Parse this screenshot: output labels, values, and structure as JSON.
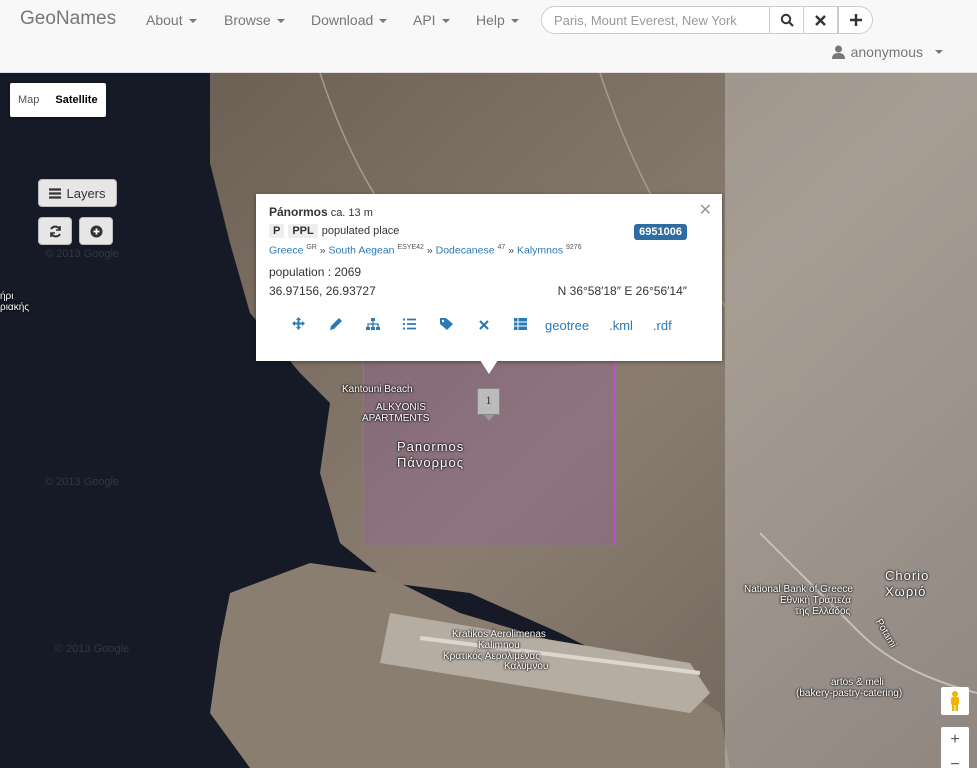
{
  "navbar": {
    "brand": "GeoNames",
    "menu": [
      {
        "label": "About"
      },
      {
        "label": "Browse"
      },
      {
        "label": "Download"
      },
      {
        "label": "API"
      },
      {
        "label": "Help"
      }
    ],
    "search_placeholder": "Paris, Mount Everest, New York",
    "search_buttons": [
      "search-icon",
      "clear-icon",
      "add-icon"
    ],
    "user": "anonymous"
  },
  "map": {
    "type_control": {
      "map": "Map",
      "satellite": "Satellite",
      "active": "Satellite"
    },
    "layers_label": "Layers",
    "watermark": "© 2013 Google",
    "labels": {
      "kantouni": "Kantouni Beach",
      "alkyonis1": "ALKYONIS",
      "alkyonis2": "APARTMENTS",
      "panormos_en": "Panormos",
      "panormos_gr": "Πάνορμος",
      "chorio_en": "Chorio",
      "chorio_gr": "Χωριό",
      "bank1": "National Bank of Greece",
      "bank2": "Εθνική Τράπεζα",
      "bank3": "της Ελλάδος",
      "potami": "Potami",
      "airport1": "Kratikos Aerolimenas",
      "airport2": "Kalimnou",
      "airport3": "Κρατικός Αερολιμένας",
      "airport4": "Καλύμνου",
      "bakery1": "artos & meli",
      "bakery2": "(bakery-pastry-catering)",
      "edge1": "ήρι",
      "edge2": "ριακής"
    },
    "marker_label": "1"
  },
  "popup": {
    "name": "Pánormos",
    "elevation": "ca. 13 m",
    "feature_class": "P",
    "feature_code": "PPL",
    "feature_desc": "populated place",
    "geonameid": "6951006",
    "hierarchy": [
      {
        "name": "Greece",
        "code": "GR"
      },
      {
        "name": "South Aegean",
        "code": "ESYE42"
      },
      {
        "name": "Dodecanese",
        "code": "47"
      },
      {
        "name": "Kalymnos",
        "code": "9276"
      }
    ],
    "population": "population : 2069",
    "coords": "36.97156, 26.93727",
    "dms": "N 36°58′18″ E 26°56′14″",
    "links": {
      "geotree": "geotree",
      "kml": ".kml",
      "rdf": ".rdf"
    }
  },
  "colors": {
    "link": "#2a7ab8",
    "badge": "#2e6da4",
    "bbox": "#c04fd0"
  }
}
